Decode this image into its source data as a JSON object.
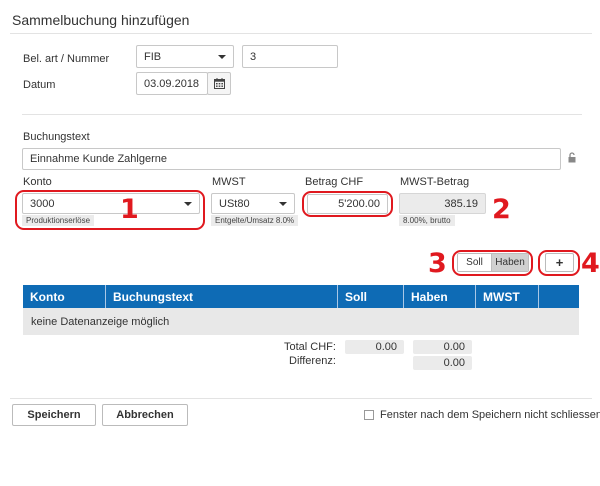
{
  "page": {
    "title": "Sammelbuchung hinzufügen"
  },
  "beleg": {
    "label": "Bel. art / Nummer",
    "type_value": "FIB",
    "number_value": "3"
  },
  "datum": {
    "label": "Datum",
    "value": "03.09.2018"
  },
  "buchungstext": {
    "label": "Buchungstext",
    "value": "Einnahme Kunde Zahlgerne"
  },
  "konto": {
    "label": "Konto",
    "value": "3000",
    "hint": "Produktionserlöse"
  },
  "mwst": {
    "label": "MWST",
    "value": "USt80",
    "hint": "Entgelte/Umsatz 8.0%"
  },
  "betrag": {
    "label": "Betrag CHF",
    "value": "5'200.00"
  },
  "mwst_betrag": {
    "label": "MWST-Betrag",
    "value": "385.19",
    "hint": "8.00%, brutto"
  },
  "toggle": {
    "soll": "Soll",
    "haben": "Haben",
    "active": "Haben"
  },
  "add_button": {
    "label": "+"
  },
  "annotations": [
    "1",
    "2",
    "3",
    "4"
  ],
  "table": {
    "columns": [
      "Konto",
      "Buchungstext",
      "Soll",
      "Haben",
      "MWST"
    ],
    "empty_text": "keine Datenanzeige möglich"
  },
  "totals": {
    "total_label": "Total CHF:",
    "total_soll": "0.00",
    "total_haben": "0.00",
    "differenz_label": "Differenz:",
    "differenz_value": "0.00"
  },
  "footer": {
    "save_label": "Speichern",
    "cancel_label": "Abbrechen",
    "keep_open_label": "Fenster nach dem Speichern nicht schliessen"
  },
  "colors": {
    "accent": "#0e6bb5",
    "annotation": "#e0191f"
  }
}
